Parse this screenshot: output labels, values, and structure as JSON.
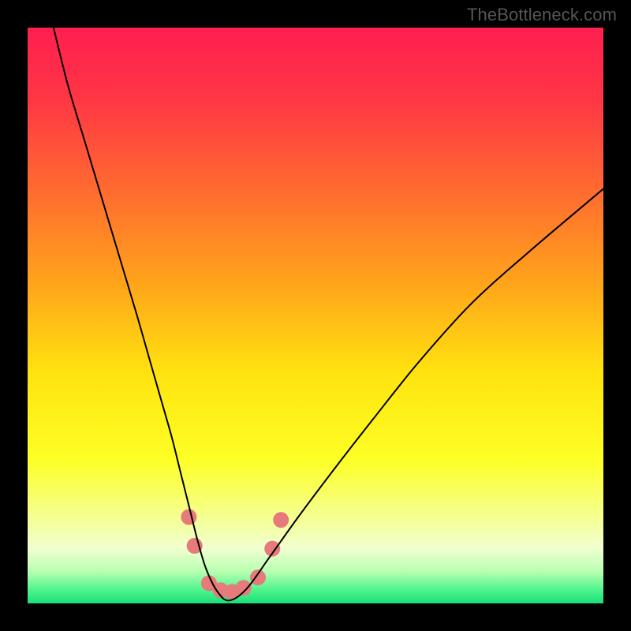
{
  "watermark": "TheBottleneck.com",
  "chart_data": {
    "type": "line",
    "title": "",
    "xlabel": "",
    "ylabel": "",
    "xlim": [
      0,
      100
    ],
    "ylim": [
      0,
      100
    ],
    "background_gradient_stops": [
      {
        "offset": 0.0,
        "color": "#ff1f4f"
      },
      {
        "offset": 0.12,
        "color": "#ff3545"
      },
      {
        "offset": 0.28,
        "color": "#ff6a30"
      },
      {
        "offset": 0.45,
        "color": "#ffa61a"
      },
      {
        "offset": 0.6,
        "color": "#ffe30f"
      },
      {
        "offset": 0.75,
        "color": "#fdff25"
      },
      {
        "offset": 0.84,
        "color": "#f6ff86"
      },
      {
        "offset": 0.905,
        "color": "#f0ffd0"
      },
      {
        "offset": 0.945,
        "color": "#b7ffb0"
      },
      {
        "offset": 0.975,
        "color": "#54f58e"
      },
      {
        "offset": 1.0,
        "color": "#19e07a"
      }
    ],
    "series": [
      {
        "name": "bottleneck-curve",
        "stroke": "#000000",
        "stroke_width": 2,
        "x": [
          4.5,
          7,
          10,
          13,
          16,
          19,
          21,
          23,
          25,
          26.5,
          28,
          29.5,
          31,
          33,
          35,
          38,
          42,
          47,
          53,
          60,
          68,
          77,
          87,
          100
        ],
        "y": [
          100,
          90,
          80,
          70,
          60,
          50,
          43,
          36,
          29,
          23,
          17,
          11,
          6,
          2,
          0.5,
          2.5,
          8,
          15,
          23,
          32,
          42,
          52,
          61,
          72
        ]
      }
    ],
    "highlight_markers": {
      "name": "optimal-range-dots",
      "color": "#e77a7a",
      "radius": 10,
      "points": [
        {
          "x": 28.0,
          "y": 15
        },
        {
          "x": 29.0,
          "y": 10
        },
        {
          "x": 31.5,
          "y": 3.5
        },
        {
          "x": 33.5,
          "y": 2.3
        },
        {
          "x": 35.5,
          "y": 2.0
        },
        {
          "x": 37.5,
          "y": 2.7
        },
        {
          "x": 40.0,
          "y": 4.5
        },
        {
          "x": 42.5,
          "y": 9.5
        },
        {
          "x": 44.0,
          "y": 14.5
        }
      ]
    }
  }
}
